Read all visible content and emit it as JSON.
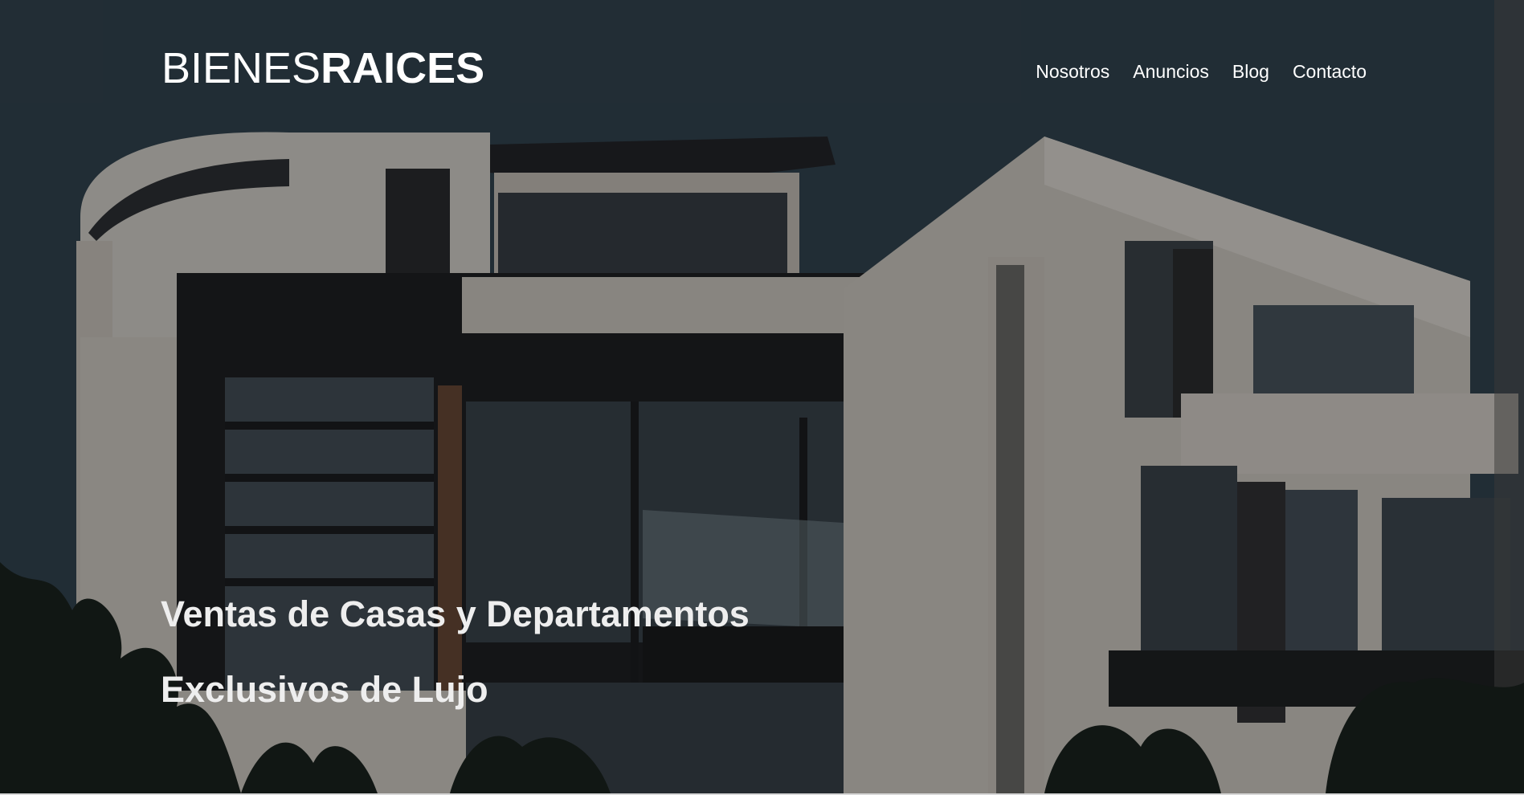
{
  "logo": {
    "light": "BIENES",
    "bold": "RAICES"
  },
  "nav": {
    "items": [
      {
        "label": "Nosotros"
      },
      {
        "label": "Anuncios"
      },
      {
        "label": "Blog"
      },
      {
        "label": "Contacto"
      }
    ]
  },
  "hero": {
    "background_image": "modern-house-photo",
    "heading": {
      "line1": "Ventas de Casas y Departamentos",
      "line2": "Exclusivos de Lujo"
    }
  },
  "colors": {
    "text": "#ffffff",
    "heading": "#eeeeee",
    "overlay": "rgba(0,0,0,0.35)"
  }
}
